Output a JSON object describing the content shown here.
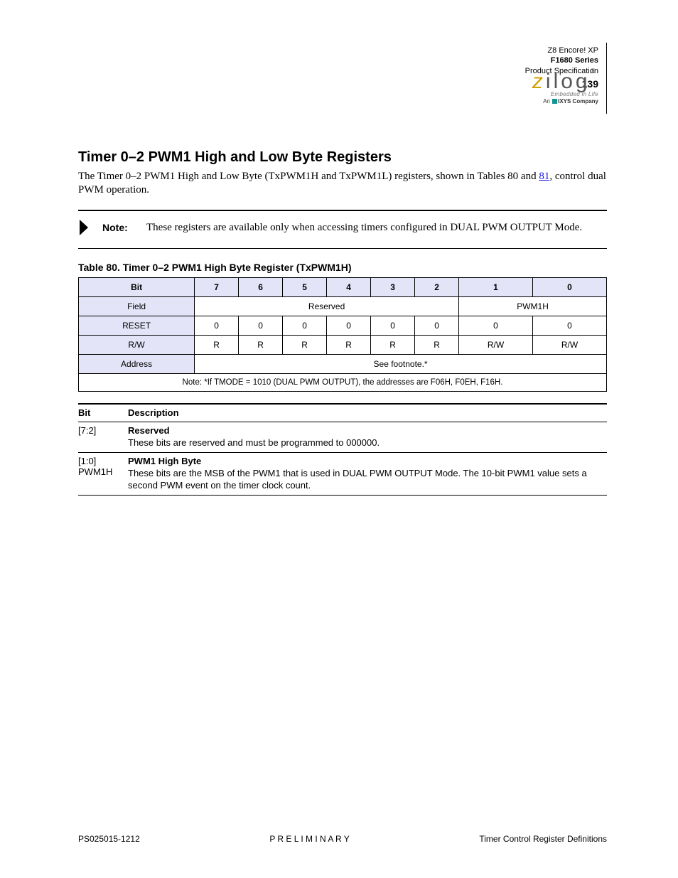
{
  "header": {
    "title_line1": "Z8 Encore! XP",
    "title_line2": "F1680 Series",
    "subtitle": "Product Specification",
    "page_no": "139"
  },
  "logo": {
    "word": "zilog",
    "sub1": "Embedded in Life",
    "sub2_pre": "An",
    "sub2_post": "IXYS Company"
  },
  "section": {
    "heading": "Timer 0–2 PWM1 High and Low Byte Registers",
    "para": "The Timer 0–2 PWM1 High and Low Byte (TxPWM1H and TxPWM1L) registers, shown in Tables 80 and ",
    "para_link_text": "81",
    "para_tail": ", control dual PWM operation."
  },
  "note": {
    "label": "Note:",
    "text": "These registers are available only when accessing timers configured in DUAL PWM OUTPUT Mode."
  },
  "table_caption": "Table 80. Timer 0–2 PWM1 High Byte Register (TxPWM1H)",
  "table": {
    "head": [
      "Bit",
      "7",
      "6",
      "5",
      "4",
      "3",
      "2",
      "1",
      "0"
    ],
    "field_label": "Field",
    "field_val_main": "Reserved",
    "field_val_tail": "PWM1H",
    "reset_label": "RESET",
    "reset_vals": [
      "0",
      "0",
      "0",
      "0",
      "0",
      "0",
      "0",
      "0"
    ],
    "rw_label": "R/W",
    "rw_vals": [
      "R",
      "R",
      "R",
      "R",
      "R",
      "R",
      "R/W",
      "R/W"
    ],
    "addr_label": "Address",
    "addr_val": "See footnote.*",
    "footnote": "Note: *If TMODE = 1010 (DUAL PWM OUTPUT), the addresses are F06H, F0EH, F16H."
  },
  "bits": {
    "head_bit": "Bit",
    "head_desc": "Description",
    "r1_bit": "[7:2]",
    "r1_title": "Reserved",
    "r1_text": "These bits are reserved and must be programmed to 000000.",
    "r2_bit": "[1:0]",
    "r2_sym": "PWM1H",
    "r2_title": "PWM1 High Byte",
    "r2_text": "These bits are the MSB of the PWM1 that is used in DUAL PWM OUTPUT Mode. The 10-bit PWM1 value sets a second PWM event on the timer clock count."
  },
  "footer": {
    "left": "PS025015-1212",
    "center": "P R E L I M I N A R Y",
    "right": "Timer Control Register Definitions"
  }
}
